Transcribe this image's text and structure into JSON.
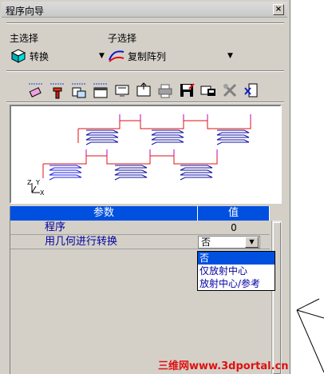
{
  "window": {
    "title": "程序向导",
    "close_label": "×"
  },
  "main_select": {
    "heading": "主选择",
    "value": "转换"
  },
  "sub_select": {
    "heading": "子选择",
    "value": "复制阵列"
  },
  "toolbar": {
    "icons": [
      "eraser-icon",
      "paint-icon",
      "copy-icon",
      "window-icon",
      "monitor-icon",
      "export-icon",
      "print-icon",
      "save-icon",
      "edit-icon",
      "tools-icon",
      "delete-icon"
    ]
  },
  "preview": {
    "axis_z": "Z",
    "axis_y": "Y",
    "axis_x": "X"
  },
  "grid": {
    "headers": {
      "param": "参数",
      "value": "值"
    },
    "rows": [
      {
        "label": "程序",
        "value": "0"
      },
      {
        "label": "用几何进行转换",
        "value": "否"
      }
    ],
    "dropdown_options": [
      "否",
      "仅放射中心",
      "放射中心/参考"
    ]
  },
  "watermark": "三维网www.3dportal.cn",
  "colors": {
    "accent": "#0050e0",
    "panel": "#d4d0c8",
    "param_text": "#0000a0",
    "red": "#e01010"
  }
}
